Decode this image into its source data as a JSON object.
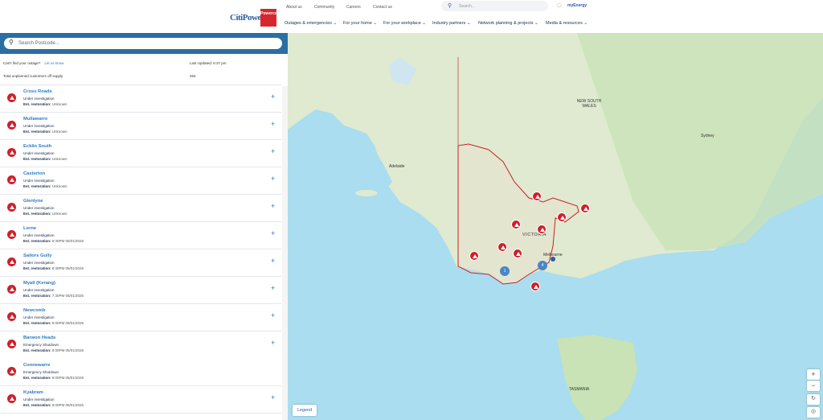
{
  "header": {
    "logo_text": "CitiPower",
    "logo_badge": "Powercor",
    "top_links": [
      "About us",
      "Community",
      "Careers",
      "Contact us"
    ],
    "search_placeholder": "Search...",
    "myenergy": "myEnergy",
    "nav": [
      "Outages & emergencies",
      "For your home",
      "For your workplace",
      "Industry partners",
      "Network planning & projects",
      "Media & resources"
    ]
  },
  "sidebar": {
    "search_placeholder": "Search Postcode...",
    "cant_find": "Can't find your outage?",
    "let_us_know": "Let us know",
    "last_updated": "Last Updated: 6:37 pm",
    "total_label": "Total unplanned customers off supply",
    "total_value": "264",
    "outages": [
      {
        "name": "Cross Roads",
        "status": "Under investigation",
        "restoration": "Unknown"
      },
      {
        "name": "Mullawarre",
        "status": "Under investigation",
        "restoration": "Unknown"
      },
      {
        "name": "Ecklin South",
        "status": "Under investigation",
        "restoration": "Unknown"
      },
      {
        "name": "Casterton",
        "status": "Under investigation",
        "restoration": "Unknown"
      },
      {
        "name": "Glenlyne",
        "status": "Under investigation",
        "restoration": "Unknown"
      },
      {
        "name": "Lorne",
        "status": "Under investigation",
        "restoration": "9:30PM 05/01/2026"
      },
      {
        "name": "Sailors Gully",
        "status": "Under investigation",
        "restoration": "8:30PM 05/01/2026"
      },
      {
        "name": "Myall (Kerang)",
        "status": "Under investigation",
        "restoration": "7:30PM 05/01/2026"
      },
      {
        "name": "Newcomb",
        "status": "Under investigation",
        "restoration": "9:00PM 05/01/2026"
      },
      {
        "name": "Barwon Heads",
        "status": "Emergency Shutdown",
        "restoration": "9:00PM 05/01/2026"
      },
      {
        "name": "Connewarre",
        "status": "Emergency Shutdown",
        "restoration": "9:00PM 05/01/2026"
      },
      {
        "name": "Kyabram",
        "status": "Under investigation",
        "restoration": "9:00PM 05/01/2026"
      }
    ],
    "restoration_prefix": "Est. restoration:"
  },
  "map": {
    "labels": {
      "adelaide": "Adelaide",
      "victoria": "VICTORIA",
      "nsw": "NEW SOUTH\nWALES",
      "sydney": "Sydney",
      "melbourne": "Melbourne",
      "tasmania": "TASMANIA"
    },
    "clusters": [
      "1",
      "4"
    ],
    "legend": "Legend",
    "zoom_in": "+",
    "zoom_out": "−"
  }
}
